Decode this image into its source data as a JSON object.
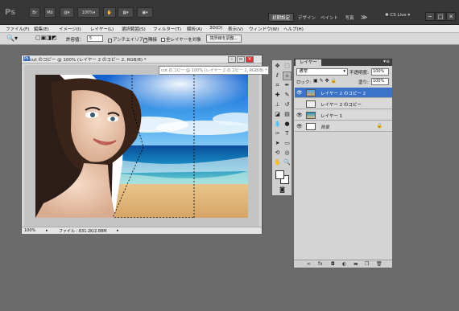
{
  "appbar": {
    "logo": "Ps",
    "zoom": "100%",
    "workspaces": [
      "初期設定",
      "デザイン",
      "ペイント",
      "写真"
    ],
    "more": "≫",
    "cslive": "CS Live",
    "controls": [
      "─",
      "□",
      "✕"
    ]
  },
  "menu": [
    "ファイル(F)",
    "編集(E)",
    "イメージ(I)",
    "レイヤー(L)",
    "選択範囲(S)",
    "フィルター(T)",
    "解析(A)",
    "3D(D)",
    "表示(V)",
    "ウィンドウ(W)",
    "ヘルプ(H)"
  ],
  "options": {
    "tolerance_label": "許容値：",
    "tolerance_value": "5",
    "antialias": "アンチエイリアス",
    "contiguous": "隣接",
    "sample_all": "全レイヤーを対象",
    "refine_edge": "境界線を調整..."
  },
  "document": {
    "title": "cut のコピー @ 100% (レイヤー 2 のコピー 2, RGB/8) *",
    "tooltip": "cut のコピー @ 100% (レイヤー 2 のコピー 2, RGB/8) *",
    "zoom": "100%",
    "file_info": "ファイル : 631.2K/2.88M"
  },
  "layers_panel": {
    "tab": "レイヤー",
    "blend_mode": "通常",
    "opacity_label": "不透明度:",
    "opacity": "100%",
    "lock_label": "ロック:",
    "fill_label": "塗り:",
    "fill": "100%",
    "layers": [
      {
        "name": "レイヤー 2 のコピー 2",
        "selected": true
      },
      {
        "name": "レイヤー 2 のコピー",
        "selected": false
      },
      {
        "name": "レイヤー 1",
        "selected": false
      },
      {
        "name": "背景",
        "selected": false
      }
    ],
    "bottom_icons": [
      "link-icon",
      "fx-icon",
      "mask-icon",
      "adjustment-icon",
      "folder-icon",
      "new-layer-icon",
      "trash-icon"
    ]
  },
  "colors": {
    "app_bg": "#6b6b6b",
    "selection": "#3a73c8"
  }
}
